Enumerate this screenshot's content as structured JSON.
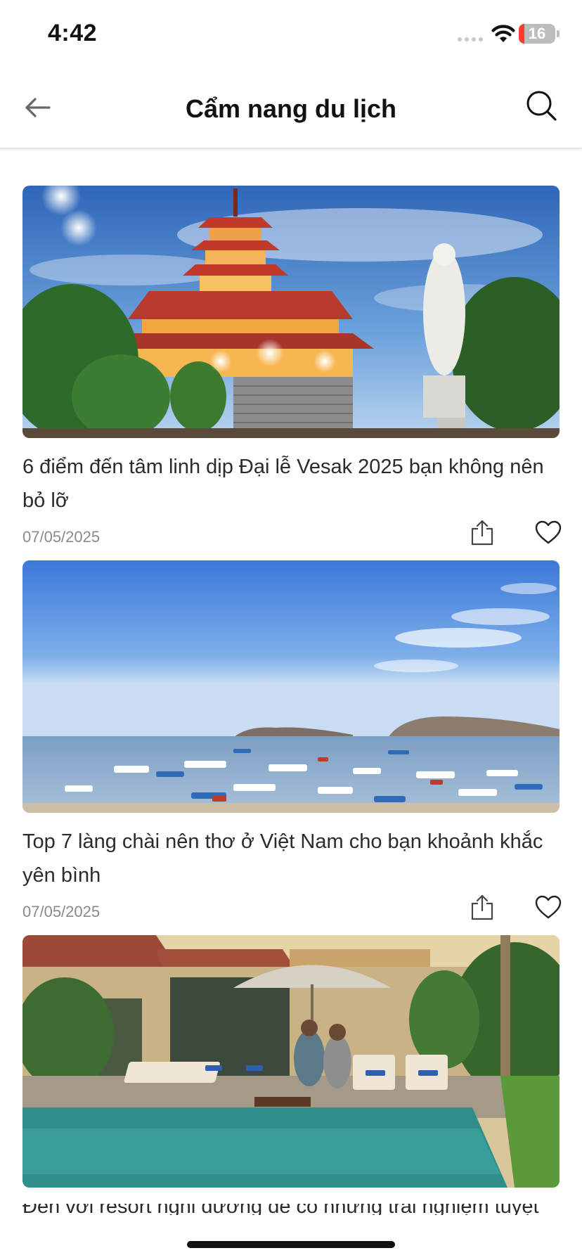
{
  "status_bar": {
    "time": "4:42",
    "battery": "16",
    "battery_color": "#ff3b30"
  },
  "header": {
    "title": "Cẩm nang du lịch",
    "back_icon": "arrow-left-icon",
    "search_icon": "search-icon"
  },
  "articles": [
    {
      "title": "6 điểm đến tâm linh dịp Đại lễ Vesak 2025 bạn không nên bỏ lỡ",
      "date": "07/05/2025",
      "image": "pagoda-and-buddha-statue-photo"
    },
    {
      "title": "Top 7 làng chài nên thơ ở Việt Nam cho bạn khoảnh khắc yên bình",
      "date": "07/05/2025",
      "image": "fishing-village-boats-photo"
    },
    {
      "title": "Đến với resort nghỉ dưỡng để có những trải nghiệm tuyệt vời",
      "date": "",
      "image": "resort-pool-couple-photo"
    }
  ],
  "icons": {
    "share": "share-icon",
    "like": "heart-icon"
  }
}
